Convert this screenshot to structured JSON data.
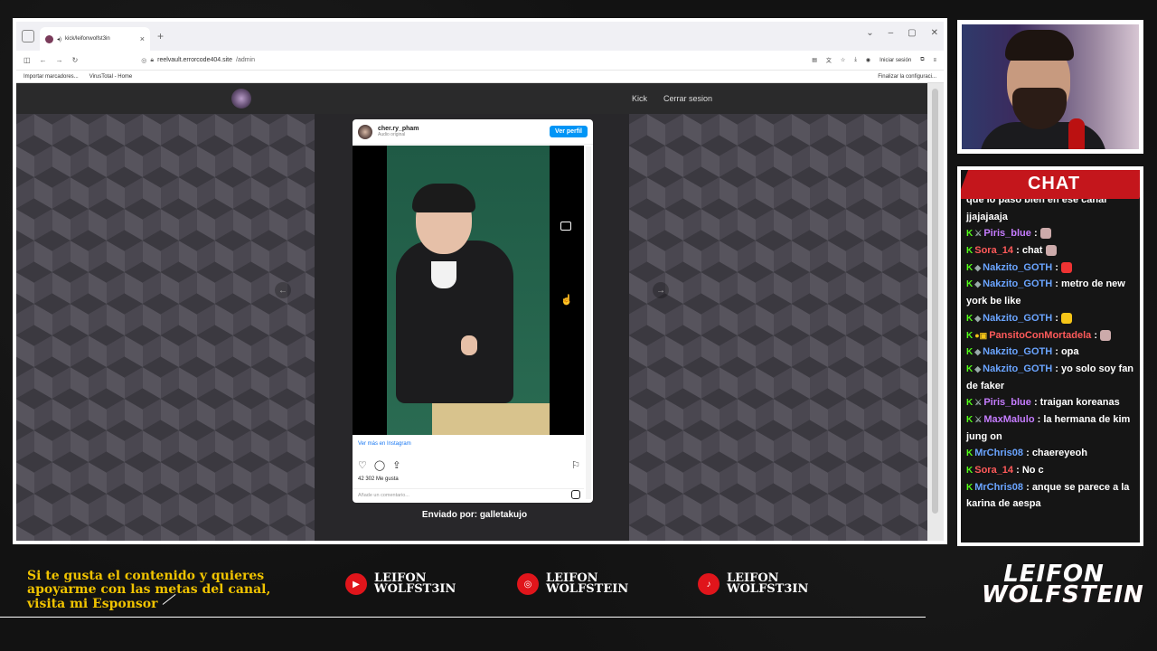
{
  "browser": {
    "tab_title": "kick/leifonwolfst3in",
    "tab_close": "×",
    "new_tab": "+",
    "url_host": "reelvault.errorcode404.site",
    "url_path": "/admin",
    "sign_in": "Iniciar sesión",
    "bookmarks": [
      "Importar marcadores...",
      "VirusTotal - Home"
    ],
    "bookmark_right": "Finalizar la configuraci..."
  },
  "site": {
    "nav": [
      "Kick",
      "Cerrar sesion"
    ],
    "sent_by": "Enviado por: galletakujo"
  },
  "instagram": {
    "username": "cher.ry_pham",
    "audio": "Audio original",
    "view_profile": "Ver perfil",
    "more_on_ig": "Ver más en Instagram",
    "likes": "42 302 Me gusta",
    "comment_placeholder": "Añade un comentario..."
  },
  "chat": {
    "title": "CHAT",
    "messages": [
      {
        "user": "",
        "text": "que lo paso bien en ese canal jjajajaaja",
        "color": "plain"
      },
      {
        "user": "Piris_blue",
        "text": ":",
        "color": "purple"
      },
      {
        "user": "Sora_14",
        "text": ": chat",
        "color": "red"
      },
      {
        "user": "Nakzito_GOTH",
        "text": ":",
        "color": "blue"
      },
      {
        "user": "Nakzito_GOTH",
        "text": ": metro de new york be like",
        "color": "blue"
      },
      {
        "user": "Nakzito_GOTH",
        "text": ":",
        "color": "blue"
      },
      {
        "user": "PansitoConMortadela",
        "text": ":",
        "color": "red"
      },
      {
        "user": "Nakzito_GOTH",
        "text": ": opa",
        "color": "blue"
      },
      {
        "user": "Nakzito_GOTH",
        "text": ": yo solo soy fan de faker",
        "color": "blue"
      },
      {
        "user": "Piris_blue",
        "text": ": traigan koreanas",
        "color": "purple"
      },
      {
        "user": "MaxMalulo",
        "text": ": la hermana de kim jung on",
        "color": "purple"
      },
      {
        "user": "MrChris08",
        "text": ": chaereyeoh",
        "color": "blue"
      },
      {
        "user": "Sora_14",
        "text": ": No c",
        "color": "red"
      },
      {
        "user": "MrChris08",
        "text": ": anque se parece a la karina de aespa",
        "color": "blue"
      }
    ]
  },
  "overlay": {
    "sponsor_text": "Si te gusta el contenido y quieres apoyarme con las metas del canal, visita mi Esponsor",
    "socials": [
      {
        "icon": "youtube-icon",
        "line1": "LEIFON",
        "line2": "WOLFST3IN"
      },
      {
        "icon": "instagram-icon",
        "line1": "LEIFON",
        "line2": "WOLFSTEIN"
      },
      {
        "icon": "tiktok-icon",
        "line1": "LEIFON",
        "line2": "WOLFST3IN"
      }
    ],
    "brand_line1": "LEIFON",
    "brand_line2": "WOLFSTEIN"
  }
}
